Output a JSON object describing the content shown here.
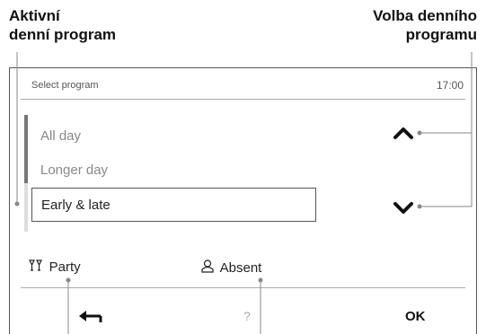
{
  "callouts": {
    "left_title_line1": "Aktivní",
    "left_title_line2": "denní program",
    "right_title_line1": "Volba denního",
    "right_title_line2": "programu"
  },
  "header": {
    "title": "Select program",
    "time": "17:00"
  },
  "programs": {
    "items": [
      "All day",
      "Longer day",
      "Early & late"
    ],
    "selected_index": 2
  },
  "footer": {
    "party_label": "Party",
    "absent_label": "Absent",
    "help_label": "?",
    "ok_label": "OK"
  },
  "icons": {
    "up": "chevron-up-icon",
    "down": "chevron-down-icon",
    "party": "cocktail-glasses-icon",
    "absent": "person-outline-icon",
    "back": "back-arrow-icon"
  }
}
